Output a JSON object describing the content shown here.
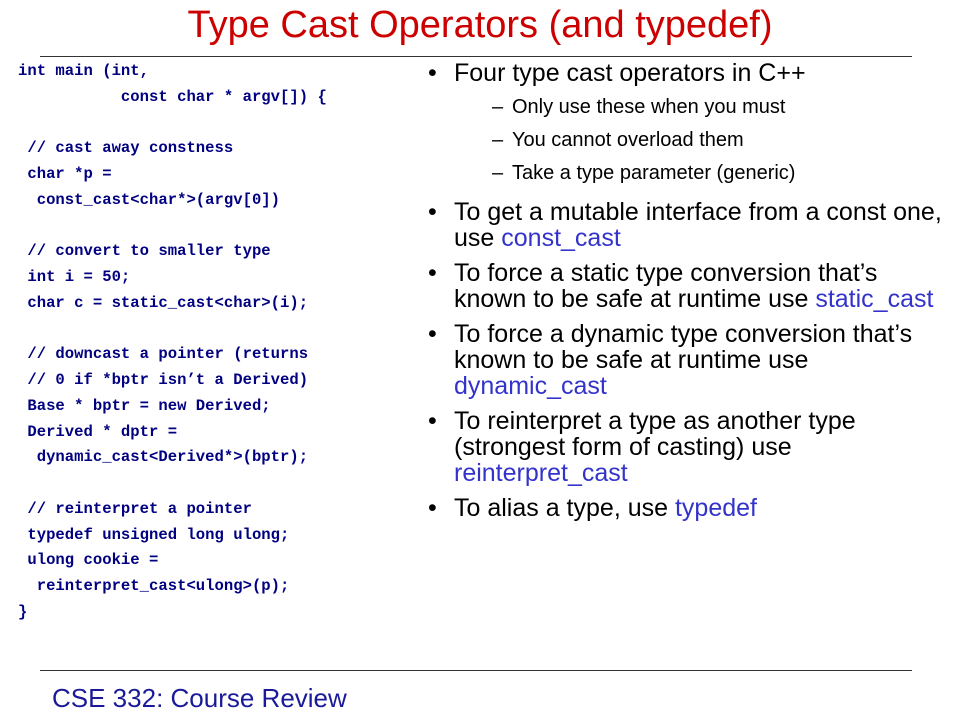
{
  "slide": {
    "title": "Type Cast Operators (and typedef)",
    "footer": "CSE 332: Course Review"
  },
  "code_lines": [
    "int main (int,",
    "           const char * argv[]) {",
    "",
    " // cast away constness",
    " char *p =",
    "  const_cast<char*>(argv[0])",
    "",
    " // convert to smaller type",
    " int i = 50;",
    " char c = static_cast<char>(i);",
    "",
    " // downcast a pointer (returns",
    " // 0 if *bptr isn’t a Derived)",
    " Base * bptr = new Derived;",
    " Derived * dptr =",
    "  dynamic_cast<Derived*>(bptr);",
    "",
    " // reinterpret a pointer",
    " typedef unsigned long ulong;",
    " ulong cookie =",
    "  reinterpret_cast<ulong>(p);",
    "}"
  ],
  "bullets": {
    "b1": {
      "text": "Four type cast operators in C++",
      "sub": [
        "Only use these when you must",
        "You cannot overload them",
        "Take a type parameter (generic)"
      ]
    },
    "b2": {
      "text": "To get a mutable interface from a const one, use ",
      "keyword": "const_cast"
    },
    "b3": {
      "text": "To force a static type conversion that’s known to be safe at runtime use ",
      "keyword": "static_cast"
    },
    "b4": {
      "text": "To force a dynamic type conversion that’s known to be safe at runtime use ",
      "keyword": "dynamic_cast"
    },
    "b5": {
      "text": "To reinterpret a type as another type (strongest form of casting) use ",
      "keyword": "reinterpret_cast"
    },
    "b6": {
      "text": "To alias a type, use ",
      "keyword": "typedef"
    }
  },
  "colors": {
    "title": "#cc0000",
    "code": "#000080",
    "keyword": "#3333cc",
    "footer": "#1a1a99"
  }
}
